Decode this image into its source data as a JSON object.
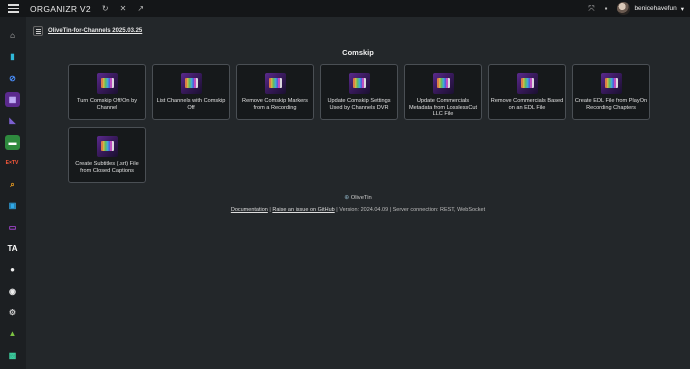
{
  "topbar": {
    "app_title": "ORGANIZR V2",
    "user_name": "benicehavefun",
    "user_caret": "▾"
  },
  "sidebar": {
    "items": [
      {
        "name": "home",
        "glyph": "⌂",
        "color": "#cfcfcf",
        "bg": "transparent"
      },
      {
        "name": "bottle",
        "glyph": "▮",
        "color": "#2fb8d8",
        "bg": "transparent"
      },
      {
        "name": "compass",
        "glyph": "⊘",
        "color": "#4a90ff",
        "bg": "transparent"
      },
      {
        "name": "olivetin",
        "glyph": "▦",
        "color": "#c7b8ff",
        "bg": "#5b2a8e"
      },
      {
        "name": "plex",
        "glyph": "◣",
        "color": "#7b5fd0",
        "bg": "transparent"
      },
      {
        "name": "flag",
        "glyph": "▬",
        "color": "#ffffff",
        "bg": "#2e8a3e"
      },
      {
        "name": "etv",
        "glyph": "E×TV",
        "color": "#ff5a3c",
        "bg": "transparent"
      },
      {
        "name": "search",
        "glyph": "⌕",
        "color": "#f0a020",
        "bg": "transparent"
      },
      {
        "name": "lock",
        "glyph": "▣",
        "color": "#2fa8e8",
        "bg": "transparent"
      },
      {
        "name": "tv",
        "glyph": "▭",
        "color": "#b04ae0",
        "bg": "transparent"
      },
      {
        "name": "ta",
        "glyph": "TA",
        "color": "#ffffff",
        "bg": "transparent"
      },
      {
        "name": "circle",
        "glyph": "●",
        "color": "#eeeeee",
        "bg": "transparent"
      },
      {
        "name": "radio",
        "glyph": "◉",
        "color": "#eeeeee",
        "bg": "transparent"
      },
      {
        "name": "gear",
        "glyph": "⚙",
        "color": "#cccccc",
        "bg": "transparent"
      },
      {
        "name": "android",
        "glyph": "▲",
        "color": "#7cc242",
        "bg": "transparent"
      },
      {
        "name": "landscape",
        "glyph": "▩",
        "color": "#3cd0a0",
        "bg": "transparent"
      }
    ]
  },
  "breadcrumb": {
    "link": "OliveTin-for-Channels 2025.03.25"
  },
  "page": {
    "title": "Comskip"
  },
  "actions": [
    {
      "label": "Turn Comskip Off/On by Channel"
    },
    {
      "label": "List Channels with Comskip Off"
    },
    {
      "label": "Remove Comskip Markers from a Recording"
    },
    {
      "label": "Update Comskip Settings Used by Channels DVR"
    },
    {
      "label": "Update Commercials Metadata from LosslessCut LLC File"
    },
    {
      "label": "Remove Commercials Based on an EDL File"
    },
    {
      "label": "Create EDL File from PlayOn Recording Chapters"
    },
    {
      "label": "Create Subtitles (.srt) File from Closed Captions"
    }
  ],
  "footer": {
    "logo_text": "OliveTin",
    "documentation": "Documentation",
    "sep1": " | ",
    "raise_issue": "Raise an issue on GitHub",
    "version_text": " | Version: 2024.04.09 | Server connection: REST, WebSocket"
  }
}
